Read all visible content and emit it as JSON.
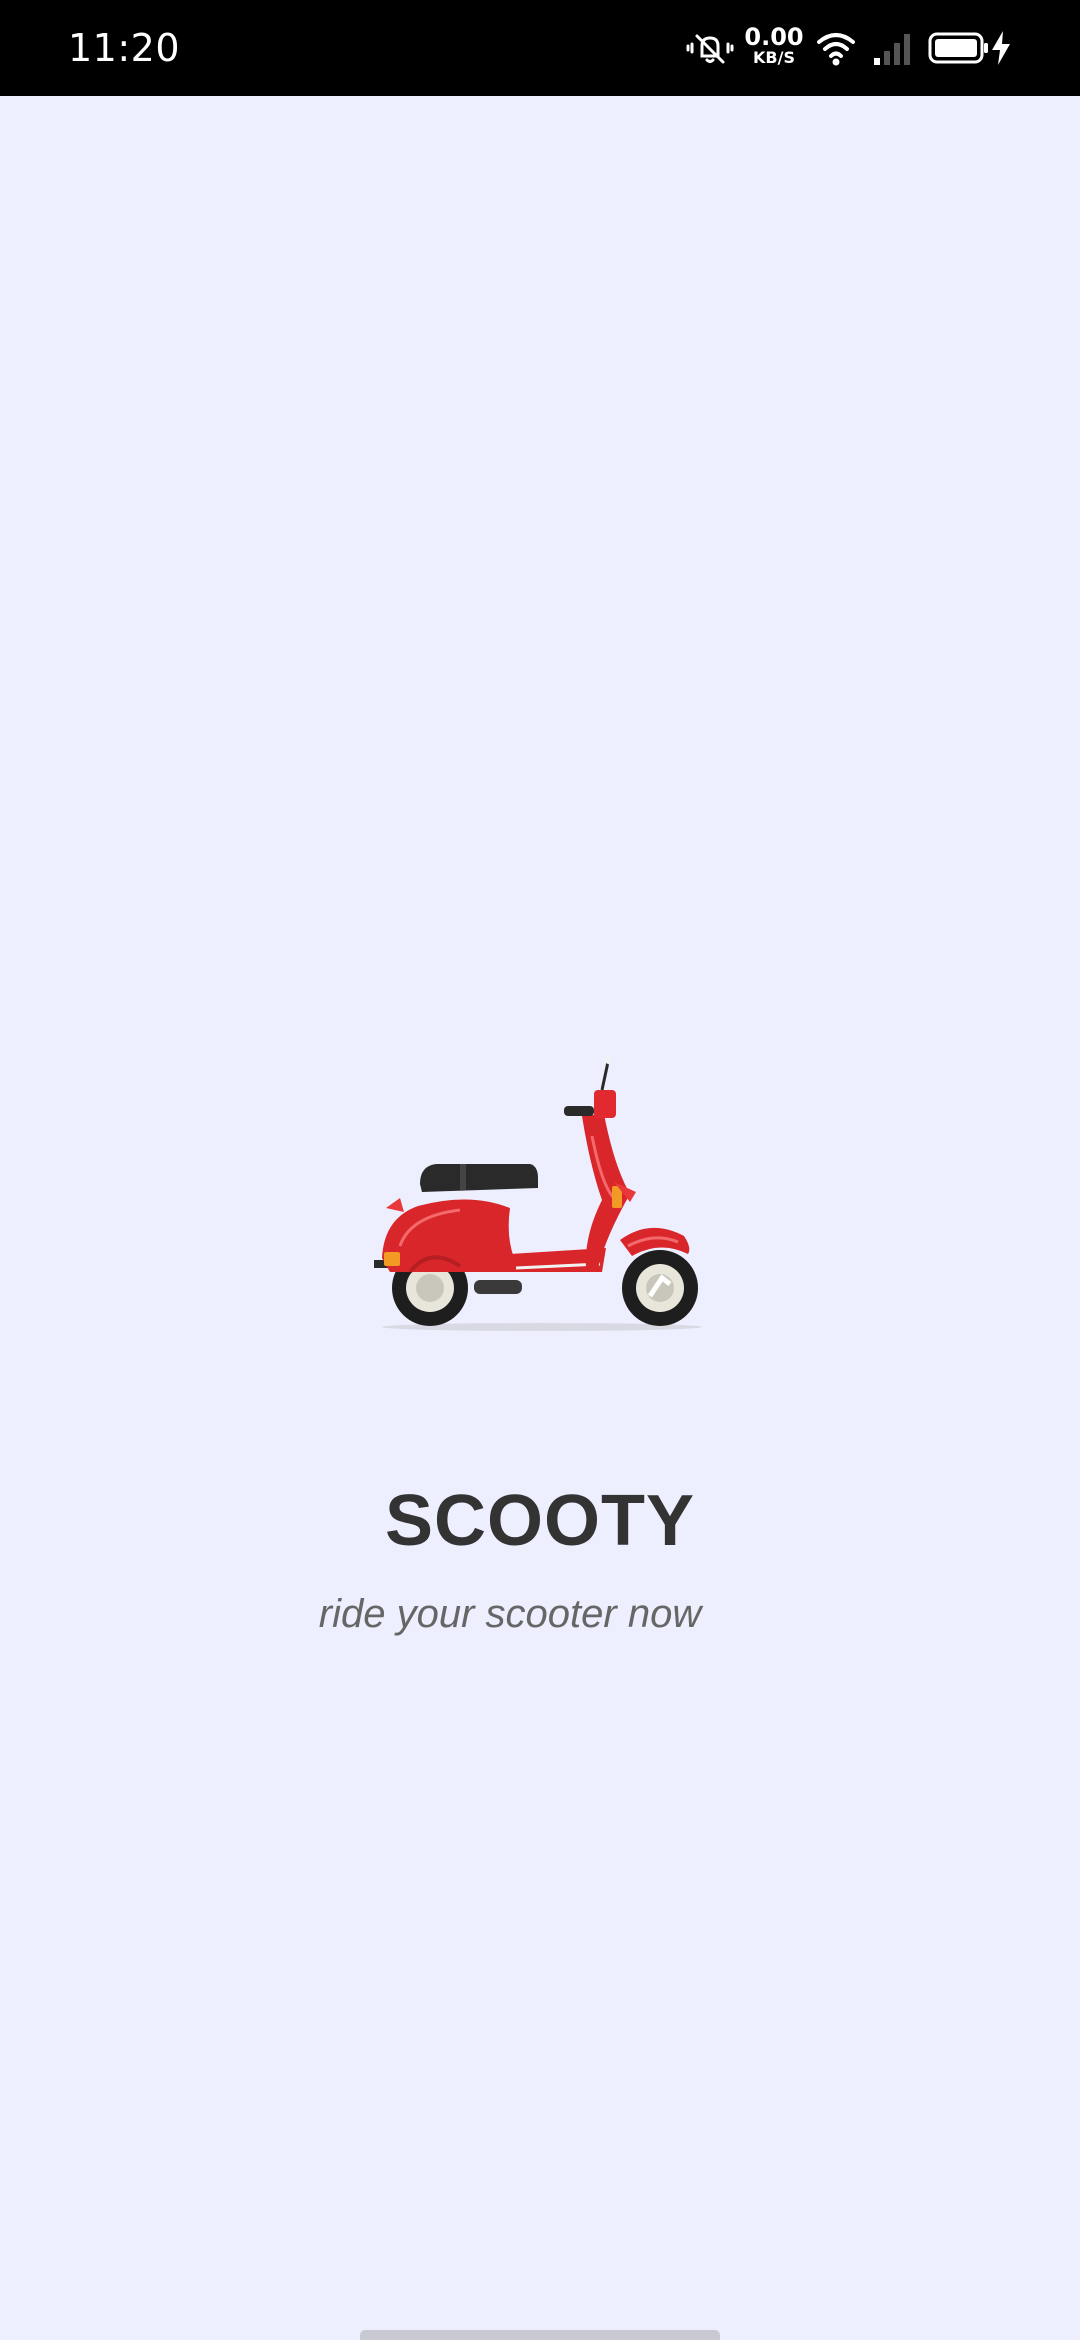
{
  "status_bar": {
    "time": "11:20",
    "net_speed_value": "0.00",
    "net_speed_unit": "KB/S",
    "icons": [
      "vibrate-mute-icon",
      "wifi-icon",
      "signal-icon",
      "battery-icon",
      "charging-icon"
    ]
  },
  "splash": {
    "title": "SCOOTY",
    "tagline": "ride your scooter now",
    "illustration": "scooter-icon"
  },
  "colors": {
    "background": "#EDEFFE",
    "status_bar": "#000000",
    "title": "#333333",
    "tagline": "#666666",
    "scooter_body": "#D9262B"
  }
}
